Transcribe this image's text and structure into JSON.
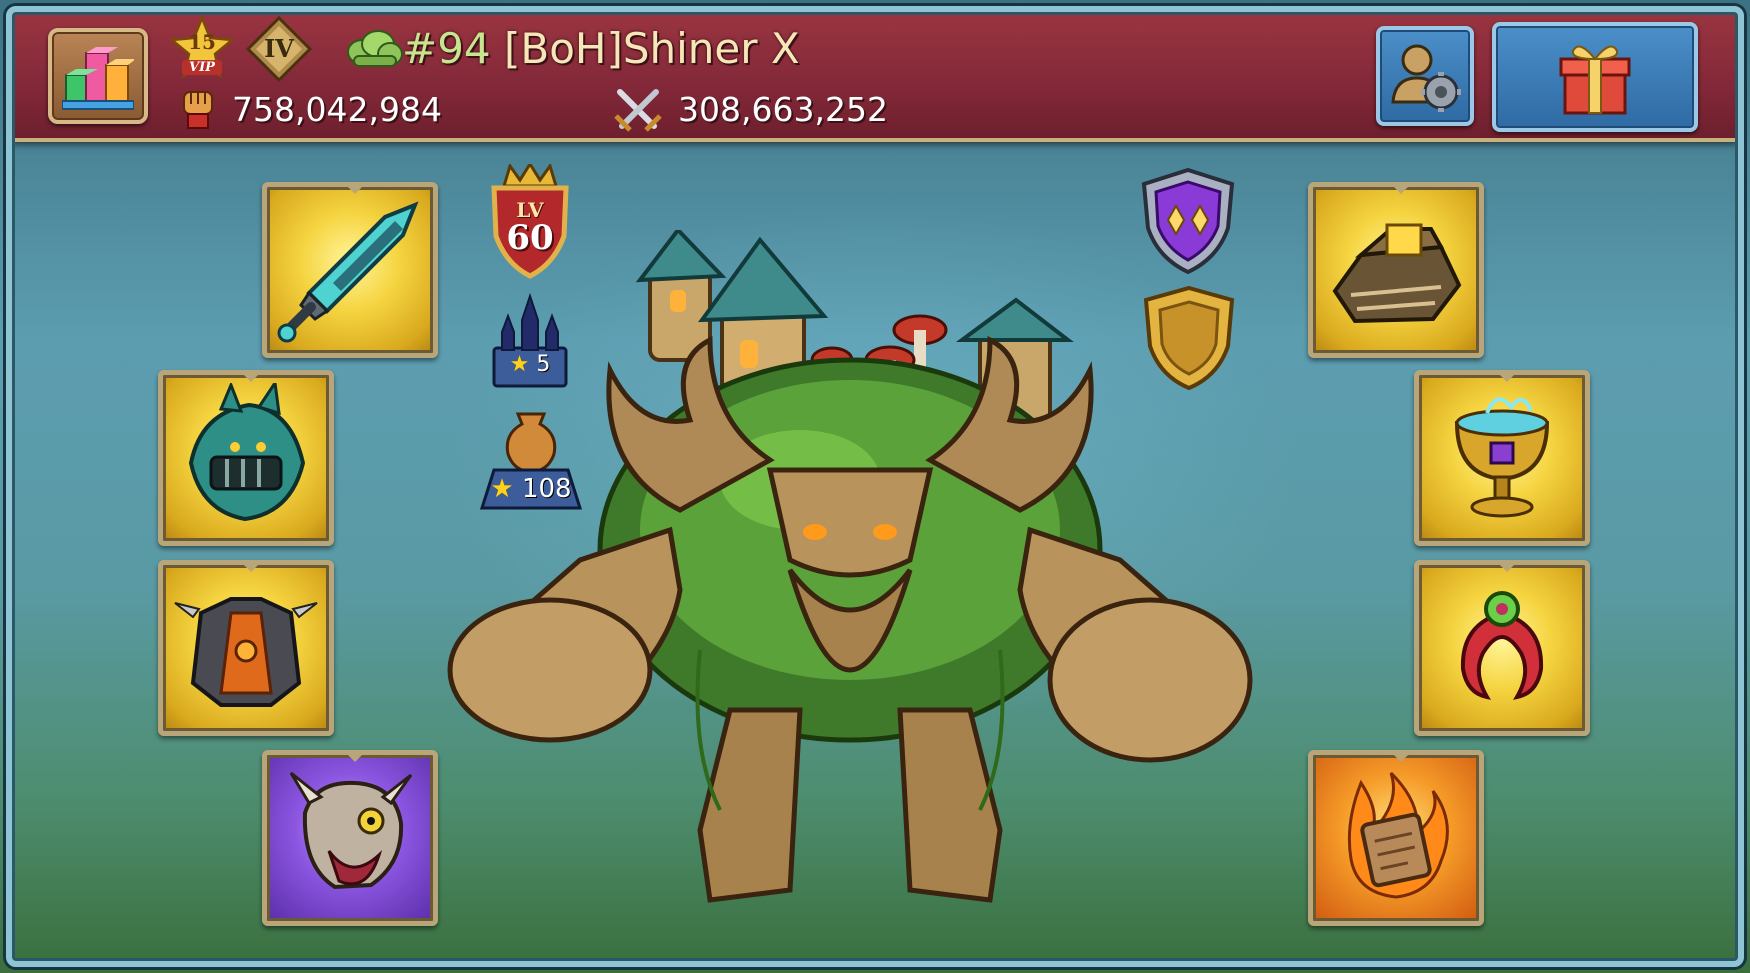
{
  "header": {
    "vip_level": "15",
    "vip_label": "VIP",
    "tier_label": "IV",
    "player_rank": "#94",
    "player_name": " [BoH]Shiner X",
    "might_value": "758,042,984",
    "troops_killed_value": "308,663,252",
    "icons": {
      "stats": "bar-chart-icon",
      "vip": "vip-star-icon",
      "tier": "tier-diamond-icon",
      "guild": "guild-cloud-icon",
      "might": "fist-icon",
      "kills": "crossed-swords-icon",
      "profile_settings": "profile-gear-icon",
      "gift": "gift-box-icon"
    }
  },
  "hero": {
    "level_prefix": "LV",
    "level_value": "60",
    "castle_stars": "5",
    "relic_stars": "108",
    "icons": {
      "castle": "castle-icon",
      "relic": "urn-icon",
      "gem_shield": "purple-gem-shield-icon",
      "gold_shield": "gold-shield-icon",
      "figure": "treant-monster-icon"
    }
  },
  "equipment": {
    "left": [
      {
        "slot": "weapon",
        "icon": "crystal-sword-icon",
        "rarity": "gold"
      },
      {
        "slot": "helmet",
        "icon": "dragon-helmet-icon",
        "rarity": "gold"
      },
      {
        "slot": "armor",
        "icon": "spiked-armor-icon",
        "rarity": "gold"
      },
      {
        "slot": "boots",
        "icon": "beast-skull-boots-icon",
        "rarity": "purple"
      }
    ],
    "right": [
      {
        "slot": "offhand",
        "icon": "chest-shield-icon",
        "rarity": "gold"
      },
      {
        "slot": "trinket",
        "icon": "chalice-icon",
        "rarity": "gold"
      },
      {
        "slot": "ring",
        "icon": "claw-amulet-icon",
        "rarity": "gold"
      },
      {
        "slot": "scroll",
        "icon": "burning-scroll-icon",
        "rarity": "orange"
      }
    ]
  },
  "colors": {
    "header_bg": "#84293a",
    "name_color": "#f6e7b8",
    "rank_color": "#c9e48f",
    "slot_gold": "#f5d440",
    "slot_purple": "#8b55e0",
    "slot_orange": "#f59a28"
  }
}
